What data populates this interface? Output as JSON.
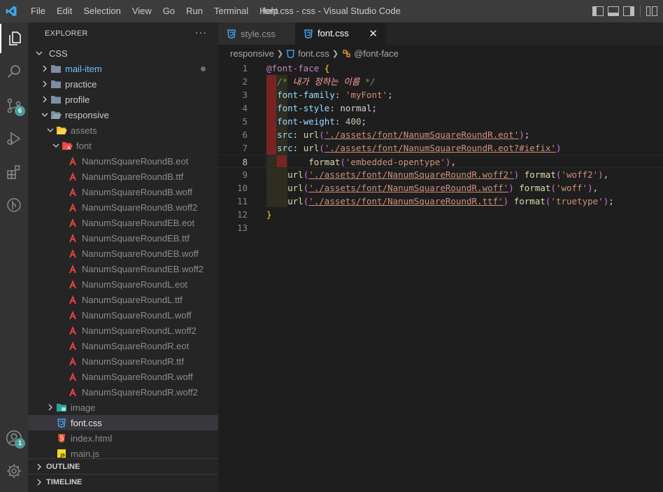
{
  "window": {
    "title": "font.css - css - Visual Studio Code",
    "menu": [
      "File",
      "Edit",
      "Selection",
      "View",
      "Go",
      "Run",
      "Terminal",
      "Help"
    ]
  },
  "activity_bar": {
    "source_control_badge": "6",
    "accounts_badge": "1"
  },
  "explorer": {
    "header": "EXPLORER",
    "more": "···",
    "root": "CSS",
    "tree": [
      {
        "label": "mail-item",
        "kind": "folder",
        "depth": 1,
        "expanded": false,
        "modified": true
      },
      {
        "label": "practice",
        "kind": "folder",
        "depth": 1,
        "expanded": false
      },
      {
        "label": "profile",
        "kind": "folder",
        "depth": 1,
        "expanded": false
      },
      {
        "label": "responsive",
        "kind": "folder",
        "depth": 1,
        "expanded": true
      },
      {
        "label": "assets",
        "kind": "folder-assets",
        "depth": 2,
        "expanded": true
      },
      {
        "label": "font",
        "kind": "folder-font",
        "depth": 3,
        "expanded": true
      },
      {
        "label": "NanumSquareRoundB.eot",
        "kind": "font-file",
        "depth": 4
      },
      {
        "label": "NanumSquareRoundB.ttf",
        "kind": "font-file",
        "depth": 4
      },
      {
        "label": "NanumSquareRoundB.woff",
        "kind": "font-file",
        "depth": 4
      },
      {
        "label": "NanumSquareRoundB.woff2",
        "kind": "font-file",
        "depth": 4
      },
      {
        "label": "NanumSquareRoundEB.eot",
        "kind": "font-file",
        "depth": 4
      },
      {
        "label": "NanumSquareRoundEB.ttf",
        "kind": "font-file",
        "depth": 4
      },
      {
        "label": "NanumSquareRoundEB.woff",
        "kind": "font-file",
        "depth": 4
      },
      {
        "label": "NanumSquareRoundEB.woff2",
        "kind": "font-file",
        "depth": 4
      },
      {
        "label": "NanumSquareRoundL.eot",
        "kind": "font-file",
        "depth": 4
      },
      {
        "label": "NanumSquareRoundL.ttf",
        "kind": "font-file",
        "depth": 4
      },
      {
        "label": "NanumSquareRoundL.woff",
        "kind": "font-file",
        "depth": 4
      },
      {
        "label": "NanumSquareRoundL.woff2",
        "kind": "font-file",
        "depth": 4
      },
      {
        "label": "NanumSquareRoundR.eot",
        "kind": "font-file",
        "depth": 4
      },
      {
        "label": "NanumSquareRoundR.ttf",
        "kind": "font-file",
        "depth": 4
      },
      {
        "label": "NanumSquareRoundR.woff",
        "kind": "font-file",
        "depth": 4
      },
      {
        "label": "NanumSquareRoundR.woff2",
        "kind": "font-file",
        "depth": 4
      },
      {
        "label": "image",
        "kind": "folder-image",
        "depth": 2,
        "expanded": false
      },
      {
        "label": "font.css",
        "kind": "css-file",
        "depth": 2,
        "selected": true
      },
      {
        "label": "index.html",
        "kind": "html-file",
        "depth": 2
      },
      {
        "label": "main.js",
        "kind": "js-file",
        "depth": 2
      }
    ],
    "sections": [
      "OUTLINE",
      "TIMELINE"
    ]
  },
  "tabs": [
    {
      "label": "style.css",
      "active": false
    },
    {
      "label": "font.css",
      "active": true,
      "close": "✕"
    }
  ],
  "breadcrumb": [
    "responsive",
    "font.css",
    "@font-face"
  ],
  "code": {
    "current_line": 8,
    "lines": [
      {
        "n": "1",
        "tokens": [
          [
            "at",
            "@font-face"
          ],
          [
            "pun",
            " "
          ],
          [
            "br",
            "{"
          ]
        ]
      },
      {
        "n": "2",
        "tokens": [
          [
            "pun",
            "  "
          ],
          [
            "cm",
            "/* "
          ],
          [
            "cm-ko",
            "내가 정하는 이름"
          ],
          [
            "cm",
            " */"
          ]
        ]
      },
      {
        "n": "3",
        "tokens": [
          [
            "pun",
            "  "
          ],
          [
            "prop",
            "font-family"
          ],
          [
            "pun",
            ": "
          ],
          [
            "str",
            "'myFont'"
          ],
          [
            "pun",
            ";"
          ]
        ]
      },
      {
        "n": "4",
        "tokens": [
          [
            "pun",
            "  "
          ],
          [
            "prop",
            "font-style"
          ],
          [
            "pun",
            ": normal;"
          ]
        ]
      },
      {
        "n": "5",
        "tokens": [
          [
            "pun",
            "  "
          ],
          [
            "prop",
            "font-weight"
          ],
          [
            "pun",
            ": "
          ],
          [
            "num",
            "400"
          ],
          [
            "pun",
            ";"
          ]
        ]
      },
      {
        "n": "6",
        "tokens": [
          [
            "pun",
            "  "
          ],
          [
            "prop",
            "src"
          ],
          [
            "pun",
            ": "
          ],
          [
            "fn",
            "url"
          ],
          [
            "paren",
            "("
          ],
          [
            "url",
            "'./assets/font/NanumSquareRoundR.eot'"
          ],
          [
            "paren",
            ")"
          ],
          [
            "pun",
            ";"
          ]
        ]
      },
      {
        "n": "7",
        "tokens": [
          [
            "pun",
            "  "
          ],
          [
            "prop",
            "src"
          ],
          [
            "pun",
            ": "
          ],
          [
            "fn",
            "url"
          ],
          [
            "paren",
            "("
          ],
          [
            "url",
            "'./assets/font/NanumSquareRoundR.eot?#iefix'"
          ],
          [
            "paren",
            ")"
          ]
        ]
      },
      {
        "n": "8",
        "tokens": [
          [
            "pun",
            "        "
          ],
          [
            "fn",
            "format"
          ],
          [
            "paren",
            "("
          ],
          [
            "str",
            "'embedded-opentype'"
          ],
          [
            "paren",
            ")"
          ],
          [
            "pun",
            ","
          ]
        ]
      },
      {
        "n": "9",
        "tokens": [
          [
            "pun",
            "    "
          ],
          [
            "fn",
            "url"
          ],
          [
            "paren",
            "("
          ],
          [
            "url",
            "'./assets/font/NanumSquareRoundR.woff2'"
          ],
          [
            "paren",
            ")"
          ],
          [
            "pun",
            " "
          ],
          [
            "fn",
            "format"
          ],
          [
            "paren",
            "("
          ],
          [
            "str",
            "'woff2'"
          ],
          [
            "paren",
            ")"
          ],
          [
            "pun",
            ","
          ]
        ]
      },
      {
        "n": "10",
        "tokens": [
          [
            "pun",
            "    "
          ],
          [
            "fn",
            "url"
          ],
          [
            "paren",
            "("
          ],
          [
            "url",
            "'./assets/font/NanumSquareRoundR.woff'"
          ],
          [
            "paren",
            ")"
          ],
          [
            "pun",
            " "
          ],
          [
            "fn",
            "format"
          ],
          [
            "paren",
            "("
          ],
          [
            "str",
            "'woff'"
          ],
          [
            "paren",
            ")"
          ],
          [
            "pun",
            ","
          ]
        ]
      },
      {
        "n": "11",
        "tokens": [
          [
            "pun",
            "    "
          ],
          [
            "fn",
            "url"
          ],
          [
            "paren",
            "("
          ],
          [
            "url",
            "'./assets/font/NanumSquareRoundR.ttf'"
          ],
          [
            "paren",
            ")"
          ],
          [
            "pun",
            " "
          ],
          [
            "fn",
            "format"
          ],
          [
            "paren",
            "("
          ],
          [
            "str",
            "'truetype'"
          ],
          [
            "paren",
            ")"
          ],
          [
            "pun",
            ";"
          ]
        ]
      },
      {
        "n": "12",
        "tokens": [
          [
            "br",
            "}"
          ]
        ]
      },
      {
        "n": "13",
        "tokens": []
      }
    ]
  },
  "colors": {
    "accent_blue": "#75beff",
    "font_icon_red": "#e8453c",
    "css_icon_blue": "#42a5f5",
    "badge_teal": "#4d9d9a"
  }
}
